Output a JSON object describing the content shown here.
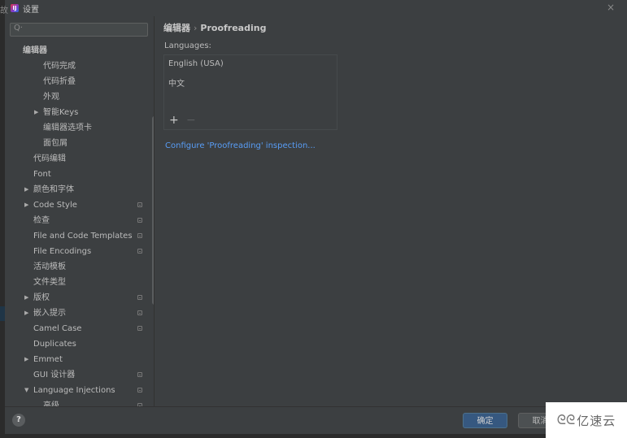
{
  "window": {
    "left_fragment": "故",
    "app_icon": "IJ",
    "title": "设置",
    "close_icon": "×"
  },
  "sidebar": {
    "search": {
      "icon": "Q·",
      "value": "",
      "placeholder": ""
    },
    "items": [
      {
        "label": "编辑器",
        "level": 0,
        "arrow": "",
        "bold": true,
        "project_icon": false
      },
      {
        "label": "代码完成",
        "level": 2,
        "arrow": "",
        "project_icon": false
      },
      {
        "label": "代码折叠",
        "level": 2,
        "arrow": "",
        "project_icon": false
      },
      {
        "label": "外观",
        "level": 2,
        "arrow": "",
        "project_icon": false
      },
      {
        "label": "智能Keys",
        "level": 2,
        "arrow": "▶",
        "project_icon": false
      },
      {
        "label": "编辑器选项卡",
        "level": 2,
        "arrow": "",
        "project_icon": false
      },
      {
        "label": "面包屑",
        "level": 2,
        "arrow": "",
        "project_icon": false
      },
      {
        "label": "代码编辑",
        "level": 1,
        "arrow": "",
        "project_icon": false
      },
      {
        "label": "Font",
        "level": 1,
        "arrow": "",
        "project_icon": false
      },
      {
        "label": "颜色和字体",
        "level": 1,
        "arrow": "▶",
        "project_icon": false
      },
      {
        "label": "Code Style",
        "level": 1,
        "arrow": "▶",
        "project_icon": true
      },
      {
        "label": "检查",
        "level": 1,
        "arrow": "",
        "project_icon": true
      },
      {
        "label": "File and Code Templates",
        "level": 1,
        "arrow": "",
        "project_icon": true
      },
      {
        "label": "File Encodings",
        "level": 1,
        "arrow": "",
        "project_icon": true
      },
      {
        "label": "活动模板",
        "level": 1,
        "arrow": "",
        "project_icon": false
      },
      {
        "label": "文件类型",
        "level": 1,
        "arrow": "",
        "project_icon": false
      },
      {
        "label": "版权",
        "level": 1,
        "arrow": "▶",
        "project_icon": true
      },
      {
        "label": "嵌入提示",
        "level": 1,
        "arrow": "▶",
        "project_icon": true
      },
      {
        "label": "Camel Case",
        "level": 1,
        "arrow": "",
        "project_icon": true
      },
      {
        "label": "Duplicates",
        "level": 1,
        "arrow": "",
        "project_icon": false
      },
      {
        "label": "Emmet",
        "level": 1,
        "arrow": "▶",
        "project_icon": false
      },
      {
        "label": "GUI 设计器",
        "level": 1,
        "arrow": "",
        "project_icon": true
      },
      {
        "label": "Language Injections",
        "level": 1,
        "arrow": "▼",
        "project_icon": true
      },
      {
        "label": "高级",
        "level": 2,
        "arrow": "",
        "project_icon": true
      }
    ]
  },
  "content": {
    "breadcrumb": {
      "parent": "编辑器",
      "separator": "›",
      "current": "Proofreading"
    },
    "languages_label": "Languages:",
    "languages": [
      "English (USA)",
      "中文"
    ],
    "add_label": "+",
    "remove_label": "−",
    "configure_link": "Configure 'Proofreading' inspection..."
  },
  "footer": {
    "help_label": "?",
    "ok_label": "确定",
    "cancel_label": "取消"
  },
  "watermark": {
    "logo": "ᘓᘓ",
    "text": "亿速云"
  }
}
